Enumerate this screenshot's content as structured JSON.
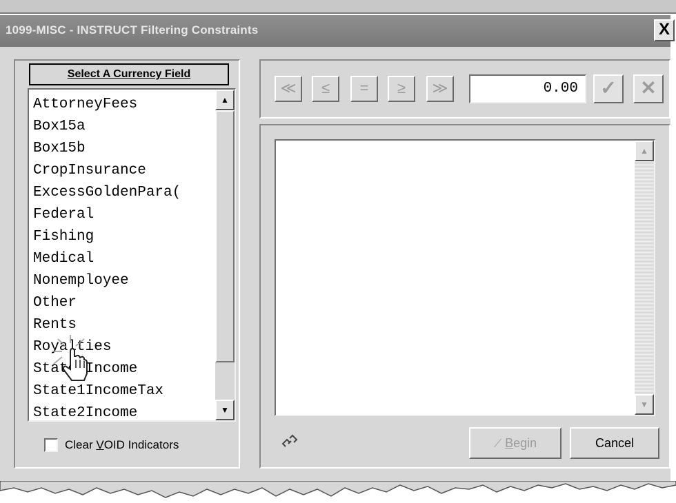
{
  "window": {
    "title": "1099-MISC - INSTRUCT Filtering Constraints",
    "close_label": "X"
  },
  "left": {
    "header": "Select A Currency Field",
    "items": [
      "AttorneyFees",
      "Box15a",
      "Box15b",
      "CropInsurance",
      "ExcessGoldenPara(",
      "Federal",
      "Fishing",
      "Medical",
      "Nonemployee",
      "Other",
      "Rents",
      "Royalties",
      "State1Income",
      "State1IncomeTax",
      "State2Income"
    ],
    "checkbox_label": "Clear VOID Indicators",
    "checkbox_checked": false
  },
  "toolbar": {
    "nav_buttons": [
      "≪",
      "≤",
      "=",
      "≥",
      "≫"
    ],
    "value": "0.00",
    "ok_icon": "checkmark-icon",
    "cancel_icon": "x-icon"
  },
  "bottom": {
    "link_icon": "link-icon",
    "begin_label": "Begin",
    "cancel_label": "Cancel"
  }
}
